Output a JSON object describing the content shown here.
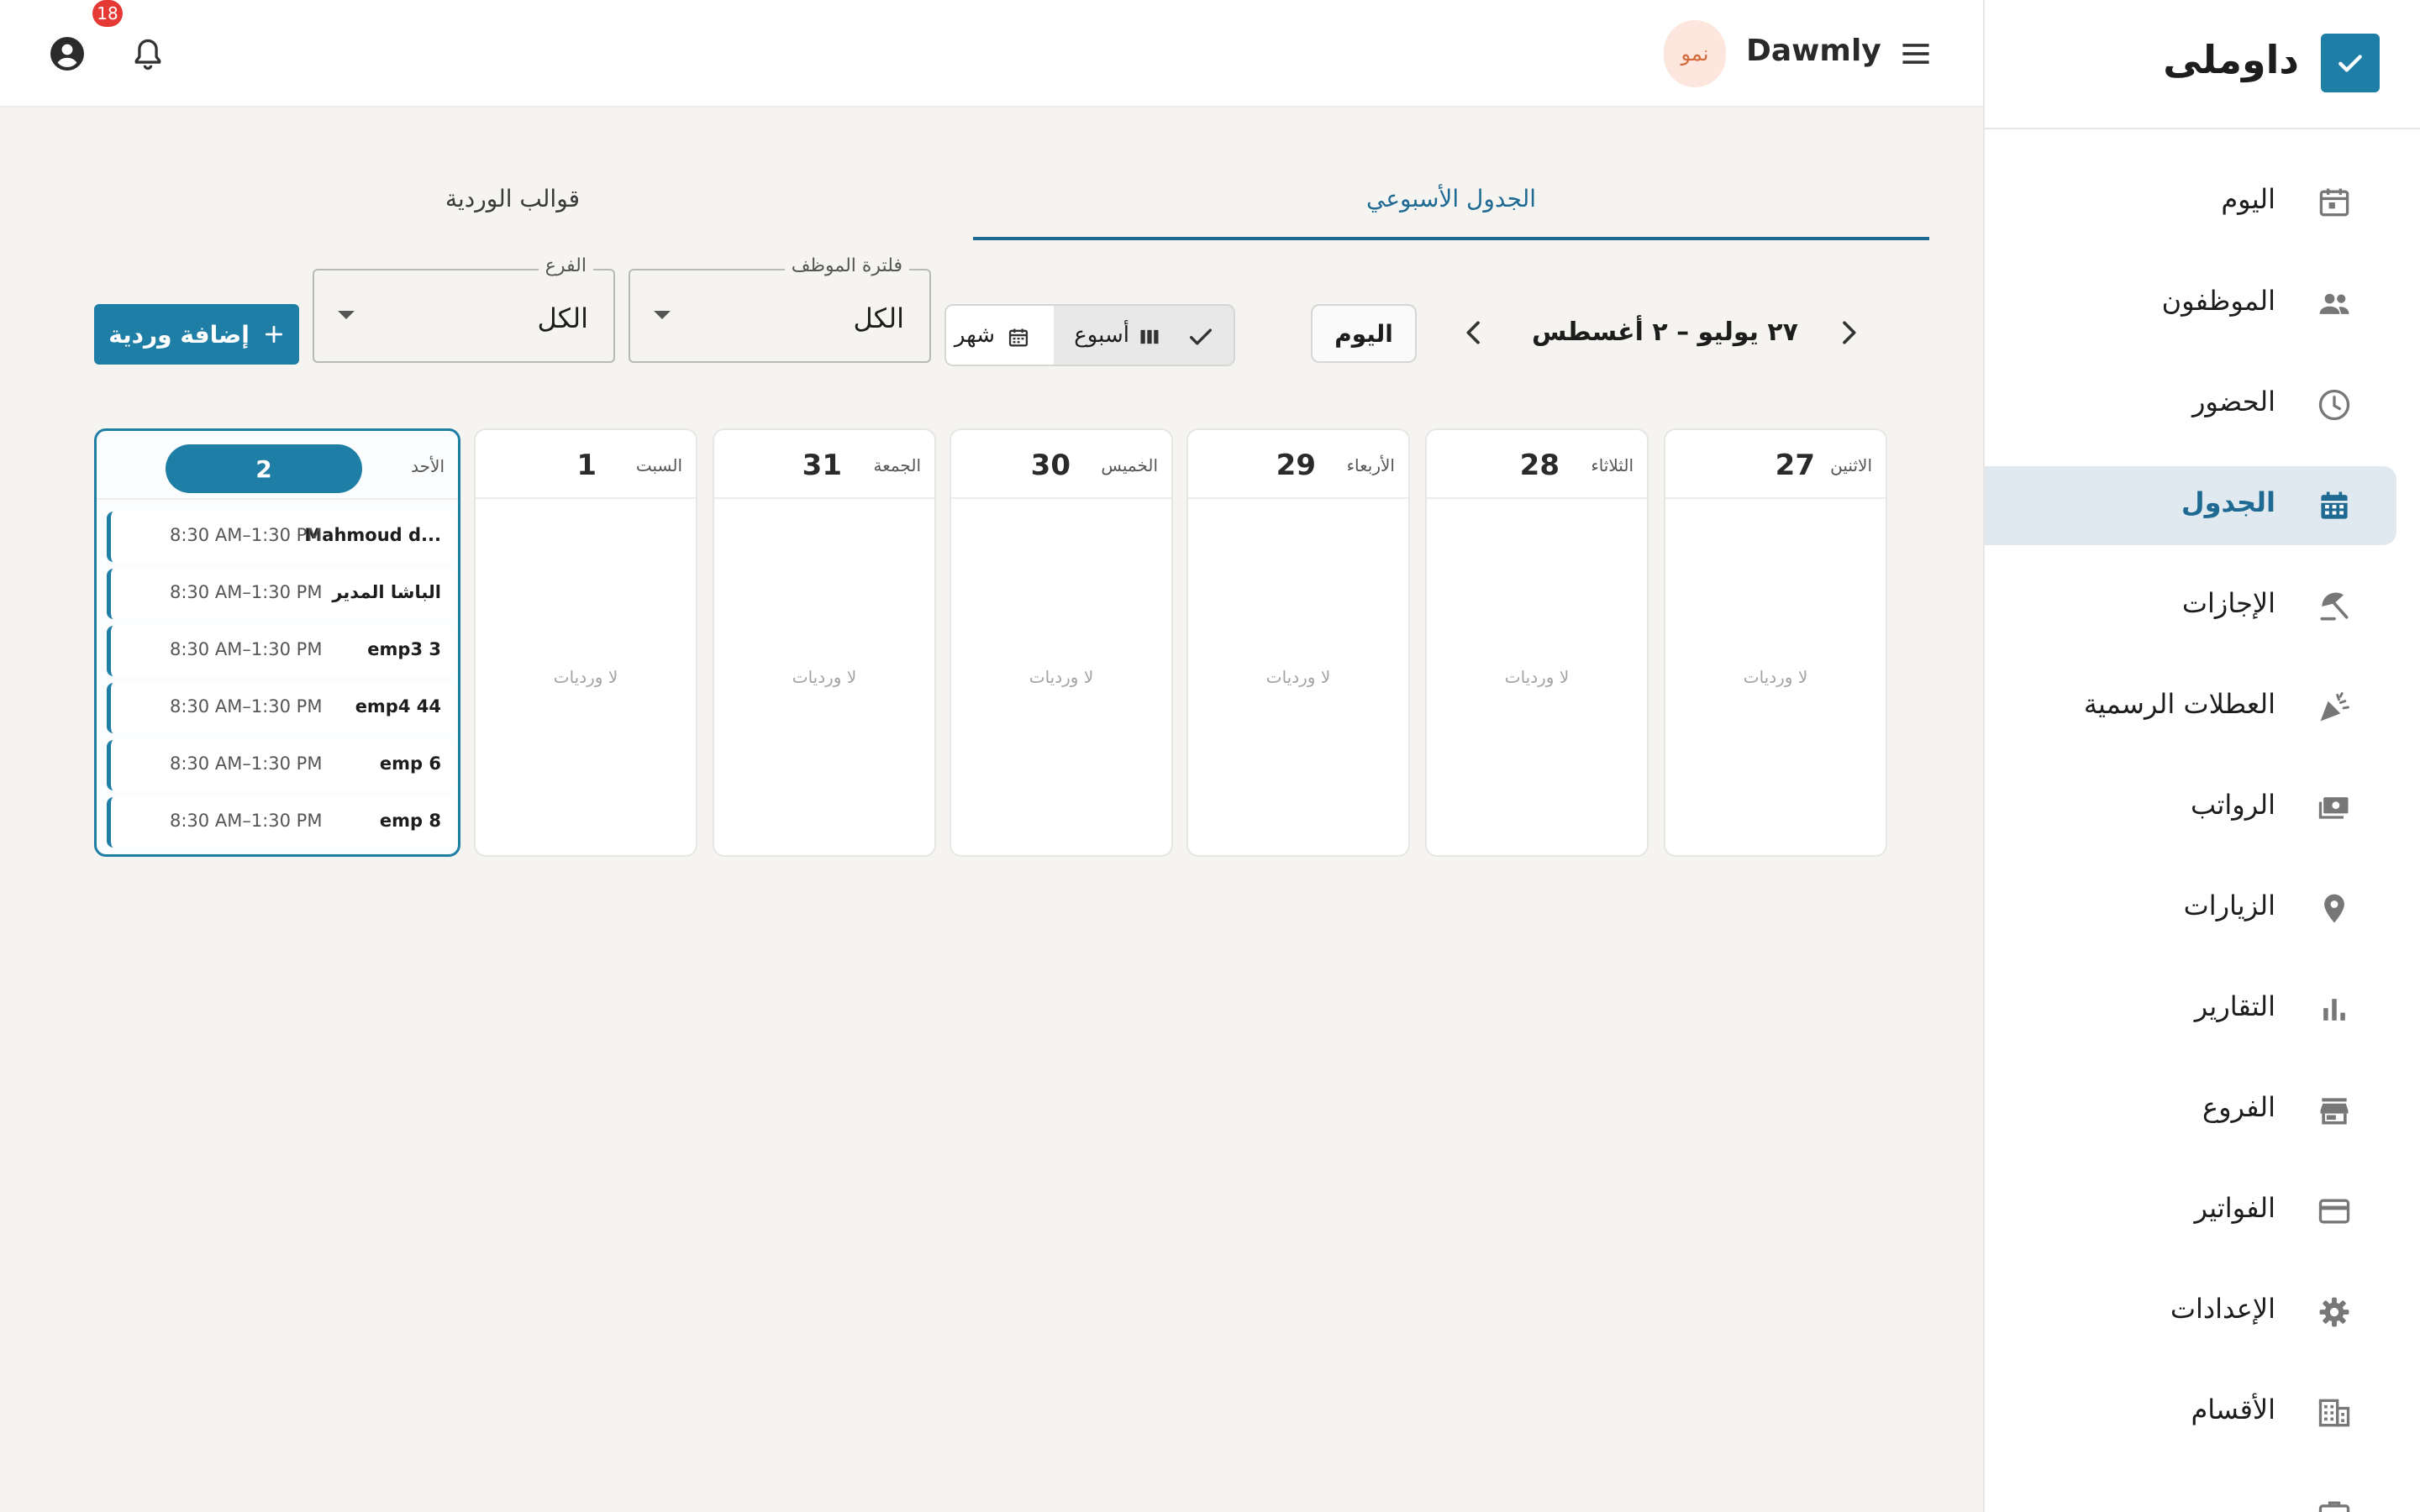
{
  "brand": {
    "name": "داوملى"
  },
  "sidebar": {
    "items": [
      {
        "label": "اليوم",
        "icon": "calendar-today-icon"
      },
      {
        "label": "الموظفون",
        "icon": "people-icon"
      },
      {
        "label": "الحضور",
        "icon": "clock-icon"
      },
      {
        "label": "الجدول",
        "icon": "calendar-grid-icon",
        "active": true
      },
      {
        "label": "الإجازات",
        "icon": "beach-umbrella-icon"
      },
      {
        "label": "العطلات الرسمية",
        "icon": "celebration-icon"
      },
      {
        "label": "الرواتب",
        "icon": "payments-icon"
      },
      {
        "label": "الزيارات",
        "icon": "location-pin-icon"
      },
      {
        "label": "التقارير",
        "icon": "bar-chart-icon"
      },
      {
        "label": "الفروع",
        "icon": "store-icon"
      },
      {
        "label": "الفواتير",
        "icon": "credit-card-icon"
      },
      {
        "label": "الإعدادات",
        "icon": "gear-icon"
      },
      {
        "label": "الأقسام",
        "icon": "building-icon"
      }
    ]
  },
  "topbar": {
    "app_name": "Dawmly",
    "user_chip": "نمو",
    "notifications_count": "18"
  },
  "tabs": {
    "weekly": "الجدول الأسبوعي",
    "templates": "قوالب الوردية"
  },
  "toolbar": {
    "date_range": "٢٧ يوليو – ٢ أغسطس",
    "today_label": "اليوم",
    "view_week": "أسبوع",
    "view_month": "شهر",
    "employee_filter_label": "فلترة الموظف",
    "employee_filter_value": "الكل",
    "branch_filter_label": "الفرع",
    "branch_filter_value": "الكل",
    "add_shift_label": "إضافة وردية"
  },
  "calendar": {
    "empty_label": "لا ورديات",
    "days": [
      {
        "name": "الاثنين",
        "num": "27"
      },
      {
        "name": "الثلاثاء",
        "num": "28"
      },
      {
        "name": "الأربعاء",
        "num": "29"
      },
      {
        "name": "الخميس",
        "num": "30"
      },
      {
        "name": "الجمعة",
        "num": "31"
      },
      {
        "name": "السبت",
        "num": "1"
      },
      {
        "name": "الأحد",
        "num": "2",
        "today": true,
        "shifts": [
          {
            "employee": "Mahmoud d...",
            "time": "8:30 AM–1:30 PM"
          },
          {
            "employee": "الباشا المدير",
            "time": "8:30 AM–1:30 PM"
          },
          {
            "employee": "emp3 3",
            "time": "8:30 AM–1:30 PM"
          },
          {
            "employee": "emp4 44",
            "time": "8:30 AM–1:30 PM"
          },
          {
            "employee": "emp 6",
            "time": "8:30 AM–1:30 PM"
          },
          {
            "employee": "emp 8",
            "time": "8:30 AM–1:30 PM"
          }
        ]
      }
    ]
  },
  "colors": {
    "accent": "#1f7ea5",
    "active_bg": "#dfe9ef",
    "badge": "#e53935"
  }
}
